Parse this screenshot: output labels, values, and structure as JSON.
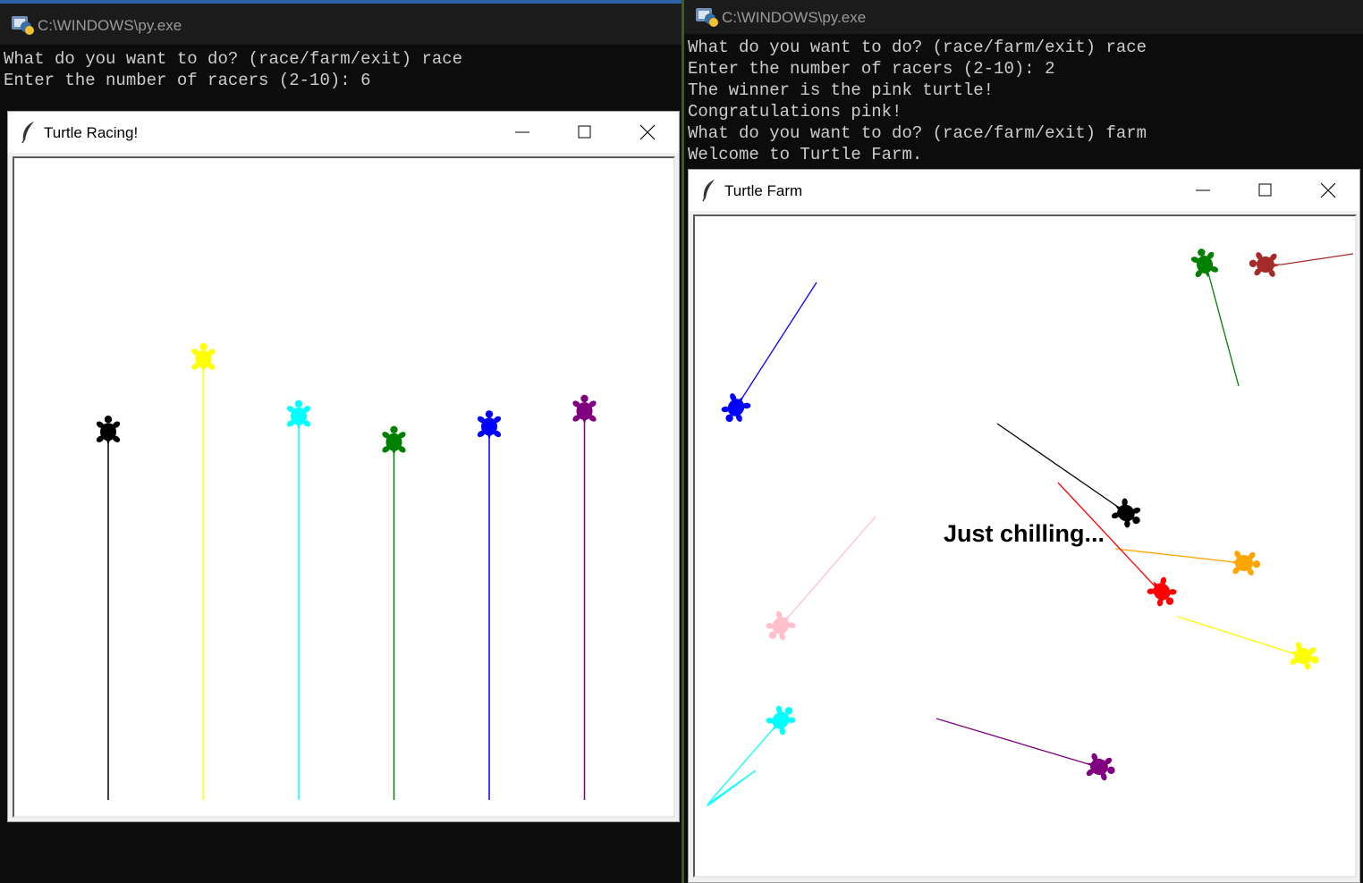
{
  "console_left": {
    "title": "C:\\WINDOWS\\py.exe",
    "lines": [
      "What do you want to do? (race/farm/exit) race",
      "Enter the number of racers (2-10): 6"
    ]
  },
  "console_right": {
    "title": "C:\\WINDOWS\\py.exe",
    "lines": [
      "What do you want to do? (race/farm/exit) race",
      "Enter the number of racers (2-10): 2",
      "The winner is the pink turtle!",
      "Congratulations pink!",
      "What do you want to do? (race/farm/exit) farm",
      "Welcome to Turtle Farm."
    ]
  },
  "race_window": {
    "title": "Turtle Racing!",
    "icon": "feather-icon",
    "controls": [
      "minimize-icon",
      "maximize-icon",
      "close-icon"
    ],
    "racers": [
      {
        "color": "#000000",
        "progress": 0.71
      },
      {
        "color": "#ffff00",
        "progress": 0.85
      },
      {
        "color": "#00ffff",
        "progress": 0.74
      },
      {
        "color": "#008000",
        "progress": 0.69
      },
      {
        "color": "#0000ff",
        "progress": 0.72
      },
      {
        "color": "#800080",
        "progress": 0.75
      }
    ]
  },
  "farm_window": {
    "title": "Turtle Farm",
    "icon": "feather-icon",
    "controls": [
      "minimize-icon",
      "maximize-icon",
      "close-icon"
    ],
    "status_text": "Just chilling...",
    "turtles": [
      {
        "name": "blue",
        "color": "#0000ff"
      },
      {
        "name": "green",
        "color": "#008000"
      },
      {
        "name": "brown",
        "color": "#a52a2a"
      },
      {
        "name": "black",
        "color": "#000000"
      },
      {
        "name": "red",
        "color": "#ff0000"
      },
      {
        "name": "orange",
        "color": "#ffa500"
      },
      {
        "name": "yellow",
        "color": "#ffff00"
      },
      {
        "name": "pink",
        "color": "#ffc0cb"
      },
      {
        "name": "cyan",
        "color": "#00ffff"
      },
      {
        "name": "purple",
        "color": "#800080"
      }
    ]
  }
}
